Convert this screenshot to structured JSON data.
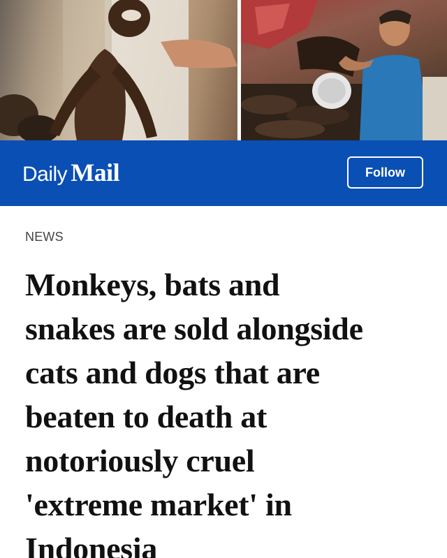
{
  "hero": {
    "left_photo": "monkey-carcass-photo",
    "right_photo": "market-vendor-photo"
  },
  "brand": {
    "logo_daily": "Daily",
    "logo_mail": "Mail",
    "follow_label": "Follow",
    "bar_color": "#0a4fb4"
  },
  "article": {
    "section": "NEWS",
    "headline": "Monkeys, bats and\nsnakes are sold alongside\ncats and dogs that are\nbeaten to death at\nnotoriously cruel\n'extreme market' in\nIndonesia"
  }
}
